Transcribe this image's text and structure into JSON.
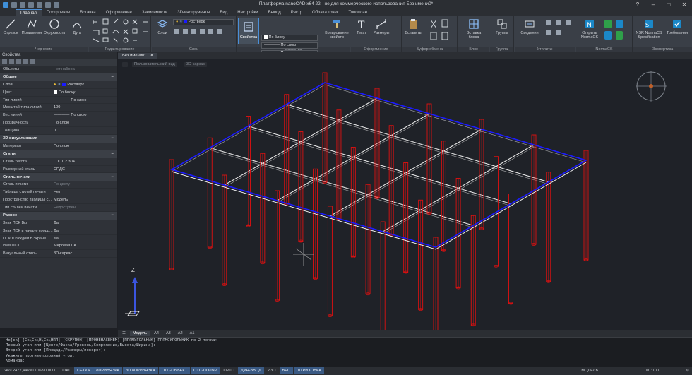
{
  "app": {
    "title": "Платформа nanoCAD x64 22 - не для коммерческого использования Без имени0*"
  },
  "tabs": [
    "Главная",
    "Построение",
    "Вставка",
    "Оформление",
    "Зависимости",
    "3D-инструменты",
    "Вид",
    "Настройки",
    "Вывод",
    "Растр",
    "Облака точек",
    "Топоплан"
  ],
  "ribbon": {
    "draw": {
      "group": "Черчение",
      "items": [
        "Отрезок",
        "Полилиния",
        "Окружность",
        "Дуга"
      ]
    },
    "edit": {
      "group": "Редактирование"
    },
    "layers": {
      "group": "Слои",
      "layer_label": "Слои",
      "current_layer": "Ростверк"
    },
    "properties": {
      "group": "Свойства",
      "button": "Свойства",
      "color": "По блоку",
      "linetype": "По слою",
      "lineweight": "По слою",
      "copy_props": "Копирование свойств"
    },
    "annotate": {
      "group": "Оформление",
      "items": [
        "Текст",
        "Размеры"
      ]
    },
    "clipboard": {
      "group": "Буфер обмена",
      "items": [
        "Вставить"
      ]
    },
    "block": {
      "group": "Блок",
      "items": [
        "Вставка блока"
      ]
    },
    "group": {
      "group": "Группа",
      "items": [
        "Группа"
      ]
    },
    "utilities": {
      "group": "Утилиты",
      "items": [
        "Сведения"
      ]
    },
    "normacs": {
      "group": "NormaCS",
      "items": [
        "Открыть NormaCS"
      ]
    },
    "expertise": {
      "group": "Экспертиза",
      "items": [
        "NSR NormaCS Specification",
        "Требования"
      ]
    }
  },
  "properties_panel": {
    "title": "Свойства",
    "objects_key": "Объекты",
    "objects_val": "Нет набора",
    "sections": [
      {
        "name": "Общие",
        "rows": [
          {
            "k": "Слой",
            "v": "Ростверк"
          },
          {
            "k": "Цвет",
            "v": "По блоку"
          },
          {
            "k": "Тип линий",
            "v": "По слою"
          },
          {
            "k": "Масштаб типа линий",
            "v": "100"
          },
          {
            "k": "Вес линий",
            "v": "По слою"
          },
          {
            "k": "Прозрачность",
            "v": "По слою"
          },
          {
            "k": "Толщина",
            "v": "0"
          }
        ]
      },
      {
        "name": "3D визуализация",
        "rows": [
          {
            "k": "Материал",
            "v": "По слою"
          }
        ]
      },
      {
        "name": "Стили",
        "rows": [
          {
            "k": "Стиль текста",
            "v": "ГОСТ 2.304"
          },
          {
            "k": "Размерный стиль",
            "v": "СПДС"
          }
        ]
      },
      {
        "name": "Стиль печати",
        "rows": [
          {
            "k": "Стиль печати",
            "v": "По цвету",
            "dim": true
          },
          {
            "k": "Таблица стилей печати",
            "v": "Нет"
          },
          {
            "k": "Пространство таблицы с...",
            "v": "Модель"
          },
          {
            "k": "Тип стилей печати",
            "v": "Недоступен",
            "dim": true
          }
        ]
      },
      {
        "name": "Разное",
        "rows": [
          {
            "k": "Знак ПСК Вкл",
            "v": "Да"
          },
          {
            "k": "Знак ПСК в начале коорд...",
            "v": "Да"
          },
          {
            "k": "ПСК в каждом ВЭкране",
            "v": "Да"
          },
          {
            "k": "Имя ПСК",
            "v": "Мировая СК"
          },
          {
            "k": "Визуальный стиль",
            "v": "3D-каркас"
          }
        ]
      }
    ]
  },
  "document": {
    "tab": "Без имени0*"
  },
  "viewport": {
    "view_label": "Пользовательский вид",
    "style_label": "3D-каркас",
    "minus_label": "-",
    "axis_z": "Z"
  },
  "layout_tabs": [
    "Модель",
    "A4",
    "A3",
    "A2",
    "A1"
  ],
  "command_lines": [
    "Не[ск] [Ск\\Ск\\Н\\Ск\\НПЛ] [СКРУПОН] [ПРОНЕНАСЕНЕМ] [ПРЯМУГОЛЬНИК] ПРЯМОУГОЛЬНИК по 2 точкам",
    "Первый угол или [Центр/Фаска/Уровень/Сопряжение/Высота/Ширина]:",
    "Второй угол или [Площадь/Размеры/поворот]:",
    "Укажите противоположный угол:",
    "Команда:"
  ],
  "status": {
    "coords": "7469.2472,44690.1068,0.0000",
    "buttons": [
      "ШАГ",
      "СЕТКА",
      "оПРИВЯЗКА",
      "3D оПРИВЯЗКА",
      "ОТС-ОБЪЕКТ",
      "ОТС-ПОЛЯР",
      "ОРТО",
      "ДИН-ВВОД",
      "ИЗО",
      "ВЕС",
      "ШТРИХОВКА"
    ],
    "active": [
      "СЕТКА",
      "оПРИВЯЗКА",
      "3D оПРИВЯЗКА",
      "ОТС-ОБЪЕКТ",
      "ОТС-ПОЛЯР",
      "ДИН-ВВОД",
      "ВЕС",
      "ШТРИХОВКА"
    ],
    "model": "МОДЕЛЬ",
    "scale": "м1:100"
  },
  "colors": {
    "slab_edge": "#1a1aff",
    "beam": "#e8e8e8",
    "column": "#e01010",
    "background": "#1f2228"
  }
}
